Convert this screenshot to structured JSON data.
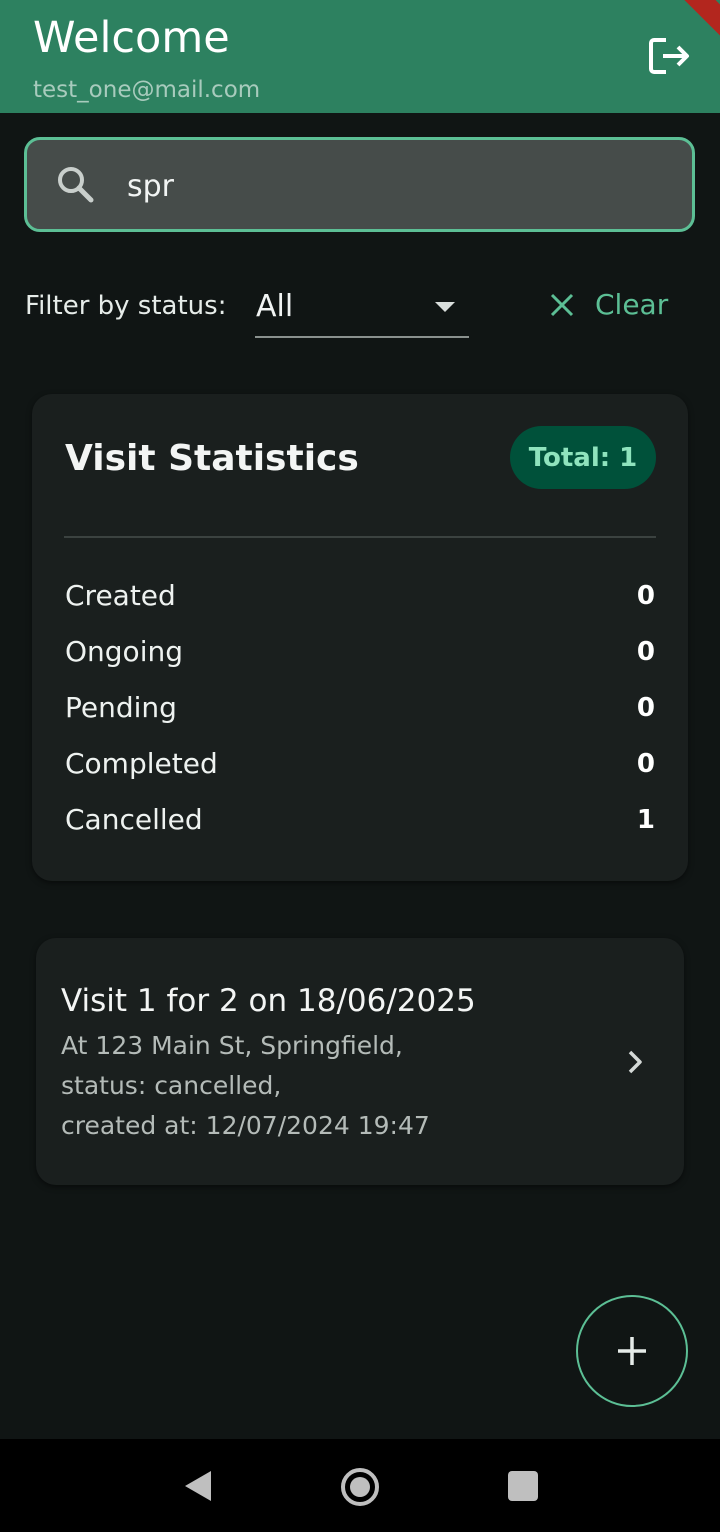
{
  "header": {
    "title": "Welcome",
    "email": "test_one@mail.com",
    "logout_icon": "logout-icon",
    "background": "#2d8160"
  },
  "search": {
    "value": "spr",
    "icon": "search-icon",
    "accent": "#5cbf95"
  },
  "filter": {
    "label": "Filter by status:",
    "selected": "All",
    "clear_label": "Clear"
  },
  "stats": {
    "title": "Visit Statistics",
    "total_label": "Total: 1",
    "rows": [
      {
        "label": "Created",
        "value": "0"
      },
      {
        "label": "Ongoing",
        "value": "0"
      },
      {
        "label": "Pending",
        "value": "0"
      },
      {
        "label": "Completed",
        "value": "0"
      },
      {
        "label": "Cancelled",
        "value": "1"
      }
    ]
  },
  "visits": [
    {
      "title": "Visit 1 for 2 on 18/06/2025",
      "location": "At 123 Main St, Springfield,",
      "status": "status: cancelled,",
      "created": "created at: 12/07/2024 19:47"
    }
  ],
  "fab": {
    "icon": "add-icon"
  },
  "system_nav": {
    "icons": [
      "back-icon",
      "home-icon",
      "recents-icon"
    ]
  }
}
